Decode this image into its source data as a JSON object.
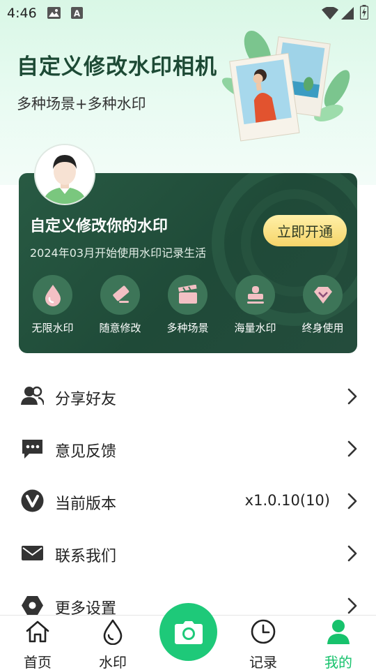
{
  "status_bar": {
    "time": "4:46",
    "icons": [
      "gallery-icon",
      "font-a-icon",
      "wifi-icon",
      "signal-icon",
      "battery-icon"
    ]
  },
  "hero": {
    "title": "自定义修改水印相机",
    "subtitle": "多种场景+多种水印"
  },
  "member_card": {
    "title": "自定义修改你的水印",
    "subtitle": "2024年03月开始使用水印记录生活",
    "button_label": "立即开通",
    "perks": [
      {
        "label": "无限水印",
        "icon": "water-drop-icon"
      },
      {
        "label": "随意修改",
        "icon": "eraser-edit-icon"
      },
      {
        "label": "多种场景",
        "icon": "clapperboard-icon"
      },
      {
        "label": "海量水印",
        "icon": "stamp-icon"
      },
      {
        "label": "终身使用",
        "icon": "diamond-icon"
      }
    ]
  },
  "menu": [
    {
      "label": "分享好友",
      "icon": "users-icon",
      "value": ""
    },
    {
      "label": "意见反馈",
      "icon": "chat-bubble-icon",
      "value": ""
    },
    {
      "label": "当前版本",
      "icon": "version-v-icon",
      "value": "x1.0.10(10)"
    },
    {
      "label": "联系我们",
      "icon": "mail-icon",
      "value": ""
    },
    {
      "label": "更多设置",
      "icon": "settings-hex-icon",
      "value": ""
    }
  ],
  "bottom_nav": {
    "items": [
      {
        "label": "首页",
        "icon": "home-icon"
      },
      {
        "label": "水印",
        "icon": "watermark-drop-icon"
      },
      {
        "label": "记录",
        "icon": "clock-icon"
      },
      {
        "label": "我的",
        "icon": "user-icon",
        "active": true
      }
    ],
    "center_icon": "camera-icon"
  },
  "colors": {
    "accent": "#1ec979",
    "card_bg": "#244f3c",
    "button_gold": "#f6d56a"
  }
}
